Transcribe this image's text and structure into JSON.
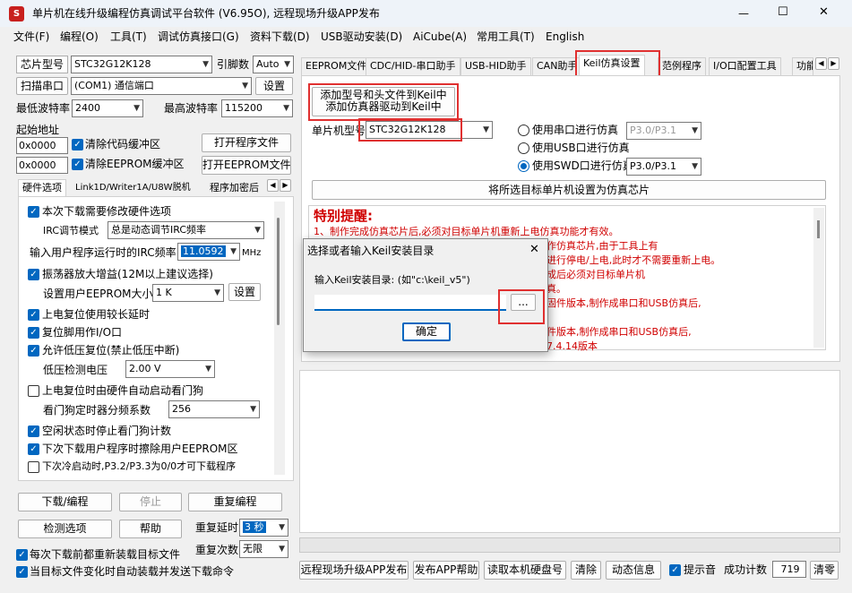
{
  "window": {
    "title": "单片机在线升级编程仿真调试平台软件 (V6.95O), 远程现场升级APP发布"
  },
  "menu": [
    "文件(F)",
    "编程(O)",
    "工具(T)",
    "调试仿真接口(G)",
    "资料下载(D)",
    "USB驱动安装(D)",
    "AiCube(A)",
    "常用工具(T)",
    "English"
  ],
  "left": {
    "chip_label": "芯片型号",
    "chip_value": "STC32G12K128",
    "pins_label": "引脚数",
    "pins_value": "Auto",
    "scan_label": "扫描串口",
    "port_value": "(COM1) 通信端口",
    "settings_btn": "设置",
    "min_baud_label": "最低波特率",
    "min_baud_value": "2400",
    "max_baud_label": "最高波特率",
    "max_baud_value": "115200",
    "start_addr_label": "起始地址",
    "addr1": "0x0000",
    "clear_code_label": "清除代码缓冲区",
    "open_prog_btn": "打开程序文件",
    "addr2": "0x0000",
    "clear_eeprom_label": "清除EEPROM缓冲区",
    "open_eeprom_btn": "打开EEPROM文件",
    "tabs": [
      "硬件选项",
      "Link1D/Writer1A/U8W脱机",
      "程序加密后"
    ],
    "opt_modify": "本次下载需要修改硬件选项",
    "irc_mode_label": "IRC调节模式",
    "irc_mode_value": "总是动态调节IRC频率",
    "irc_freq_label": "输入用户程序运行时的IRC频率",
    "irc_freq_value": "11.0592",
    "irc_unit": "MHz",
    "opt_amp": "振荡器放大增益(12M以上建议选择)",
    "eeprom_size_label": "设置用户EEPROM大小",
    "eeprom_size_value": "1   K",
    "eeprom_set_btn": "设置",
    "opt_reset_delay": "上电复位使用较长延时",
    "opt_reset_io": "复位脚用作I/O口",
    "opt_lowv": "允许低压复位(禁止低压中断)",
    "lowv_label": "低压检测电压",
    "lowv_value": "2.00 V",
    "opt_wdt": "上电复位时由硬件自动启动看门狗",
    "wdt_label": "看门狗定时器分频系数",
    "wdt_value": "256",
    "opt_idle": "空闲状态时停止看门狗计数",
    "opt_erase": "下次下载用户程序时擦除用户EEPROM区",
    "opt_cold": "下次冷启动时,P3.2/P3.3为0/0才可下载程序",
    "download_btn": "下载/编程",
    "stop_btn": "停止",
    "reprog_btn": "重复编程",
    "detect_btn": "检测选项",
    "help_btn": "帮助",
    "repeat_delay_label": "重复延时",
    "repeat_delay_value": "3 秒",
    "repeat_count_label": "重复次数",
    "repeat_count_value": "无限",
    "reload_label": "每次下载前都重新装载目标文件",
    "autoload_label": "当目标文件变化时自动装载并发送下载命令"
  },
  "right": {
    "tabs": [
      "EEPROM文件",
      "CDC/HID-串口助手",
      "USB-HID助手",
      "CAN助手",
      "Keil仿真设置",
      "范例程序",
      "I/O口配置工具",
      "功能"
    ],
    "add_keil_btn1": "添加型号和头文件到Keil中",
    "add_keil_btn2": "添加仿真器驱动到Keil中",
    "mcu_label": "单片机型号",
    "mcu_value": "STC32G12K128",
    "radio1": "使用串口进行仿真",
    "radio1_val": "P3.0/P3.1",
    "radio2": "使用USB口进行仿真",
    "radio3": "使用SWD口进行仿真",
    "radio3_val": "P3.0/P3.1",
    "set_chip_btn": "将所选目标单片机设置为仿真芯片",
    "notice_title": "特别提醒:",
    "notice_line1": "1、制作完成仿真芯片后,必须对目标单片机重新上电仿真功能才有效。",
    "notice_frag1": "作仿真芯片,由于工具上有",
    "notice_frag2": "进行停电/上电,此时才不需要重新上电。",
    "notice_frag3": "成后必须对目标单片机",
    "notice_frag4": "真。",
    "notice_frag5": "固件版本,制作成串口和USB仿真后,",
    "notice_frag6": "件版本,制作成串口和USB仿真后,",
    "notice_frag7": "7.4.14版本",
    "bottom_buttons": [
      "远程现场升级APP发布",
      "发布APP帮助",
      "读取本机硬盘号",
      "清除",
      "动态信息"
    ],
    "beep_label": "提示音",
    "success_label": "成功计数",
    "success_value": "719",
    "clear_btn": "清零"
  },
  "dialog": {
    "title": "选择或者输入Keil安装目录",
    "prompt": "输入Keil安装目录: (如\"c:\\keil_v5\")",
    "browse_btn": "...",
    "ok_btn": "确定",
    "close": "✕"
  },
  "titlebar": {
    "min": "—",
    "max": "☐",
    "close": "✕"
  }
}
